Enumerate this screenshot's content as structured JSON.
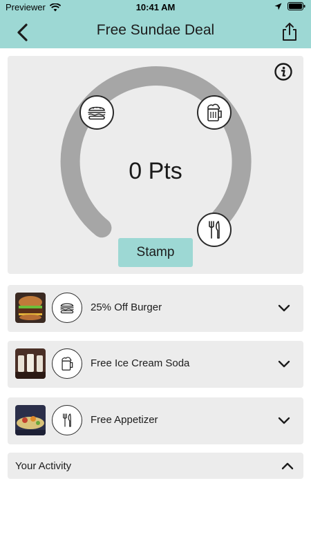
{
  "status_bar": {
    "carrier": "Previewer",
    "time": "10:41 AM"
  },
  "header": {
    "title": "Free Sundae Deal"
  },
  "points_card": {
    "points_text": "0 Pts",
    "stamp_label": "Stamp",
    "progress_fraction": 0
  },
  "rewards": [
    {
      "label": "25% Off Burger",
      "icon": "burger-icon"
    },
    {
      "label": "Free Ice Cream Soda",
      "icon": "soda-mug-icon"
    },
    {
      "label": "Free Appetizer",
      "icon": "fork-knife-icon"
    }
  ],
  "activity": {
    "label": "Your Activity"
  },
  "colors": {
    "accent": "#9dd8d4",
    "card_bg": "#ececec",
    "gauge_track": "#a6a6a6"
  }
}
